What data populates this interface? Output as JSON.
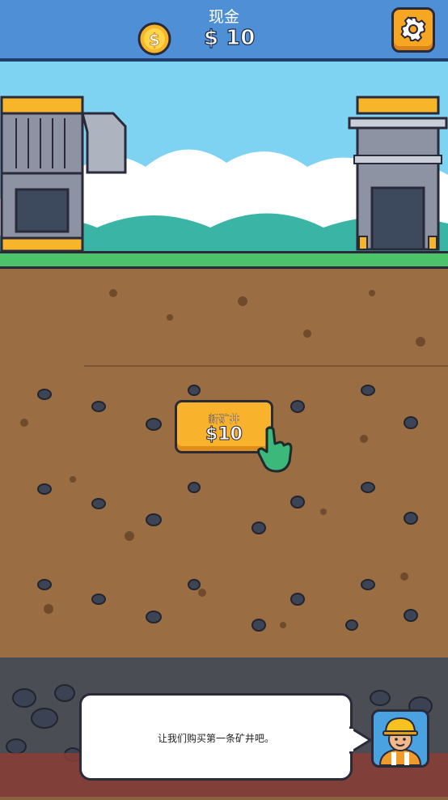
{
  "header": {
    "cash_label": "现金",
    "cash_amount": "$ 10",
    "coin_icon": "dollar-coin-icon",
    "settings_icon": "gear-icon"
  },
  "actions": {
    "new_shaft_label": "新矿井",
    "new_shaft_price": "$10",
    "hint_icon": "pointing-hand-icon"
  },
  "dialog": {
    "message": "让我们购买第一条矿井吧。",
    "avatar_icon": "miner-avatar-icon"
  },
  "colors": {
    "header_bg": "#4f8fd6",
    "button_yellow": "#f9b22c",
    "sky": "#7fd3f2",
    "grass": "#4cc36a",
    "soil": "#9b6d43",
    "rock": "#4b4d55"
  }
}
